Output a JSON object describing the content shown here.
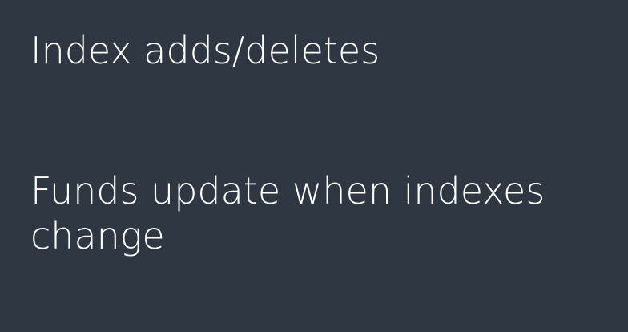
{
  "slide": {
    "background_color": "#2e3742",
    "text_color": "#ffffff",
    "items": [
      "Index adds/deletes",
      "Funds update when indexes change"
    ]
  }
}
